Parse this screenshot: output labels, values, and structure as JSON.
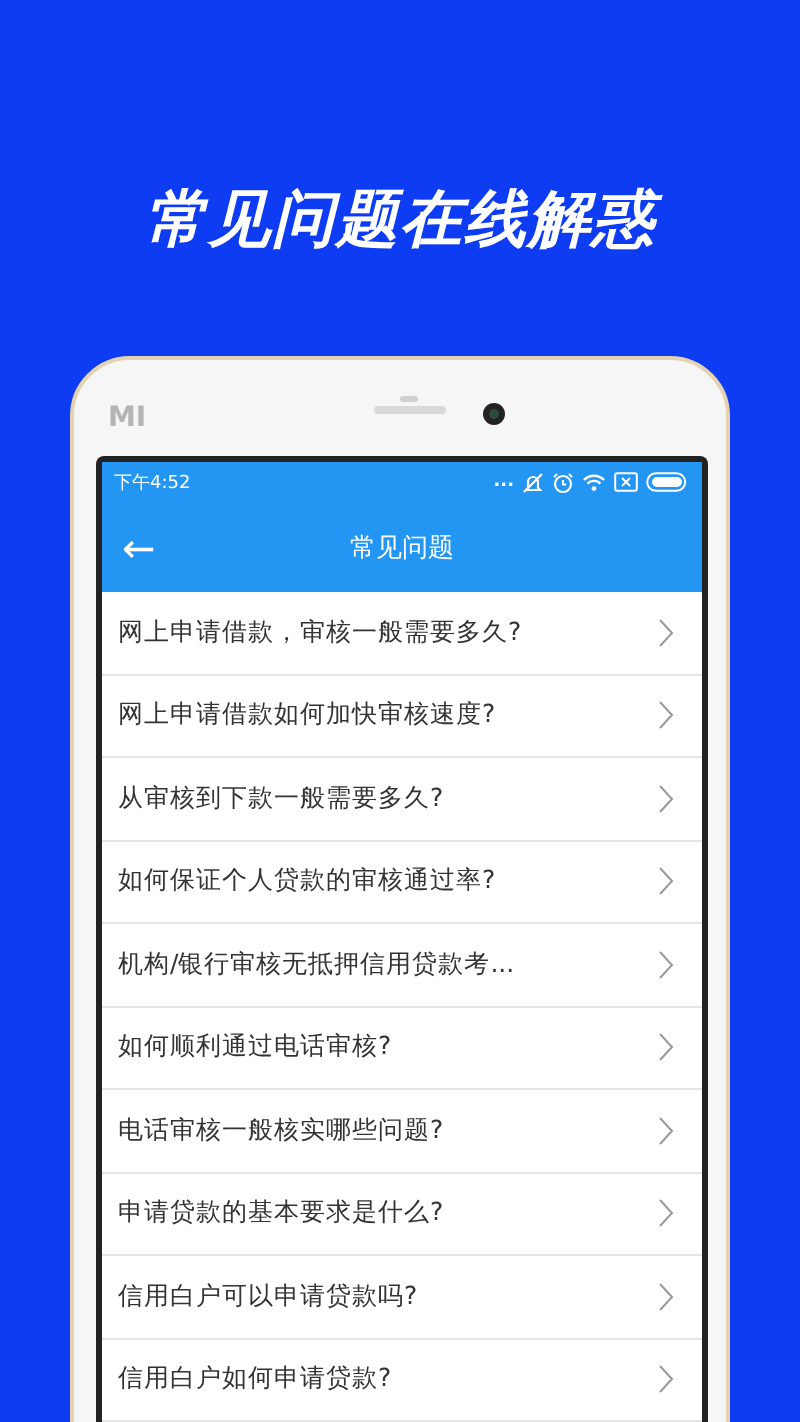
{
  "headline": "常见问题在线解惑",
  "phone": {
    "brand_mark": "MI"
  },
  "status_bar": {
    "time": "下午4:52",
    "more": "..."
  },
  "nav_bar": {
    "back": "←",
    "title": "常见问题"
  },
  "faq_items": [
    {
      "text": "网上申请借款，审核一般需要多久?"
    },
    {
      "text": "网上申请借款如何加快审核速度?"
    },
    {
      "text": "从审核到下款一般需要多久?"
    },
    {
      "text": "如何保证个人贷款的审核通过率?"
    },
    {
      "text": "机构/银行审核无抵押信用贷款考..."
    },
    {
      "text": "如何顺利通过电话审核?"
    },
    {
      "text": "电话审核一般核实哪些问题?"
    },
    {
      "text": "申请贷款的基本要求是什么?"
    },
    {
      "text": "信用白户可以申请贷款吗?"
    },
    {
      "text": "信用白户如何申请贷款?"
    }
  ]
}
